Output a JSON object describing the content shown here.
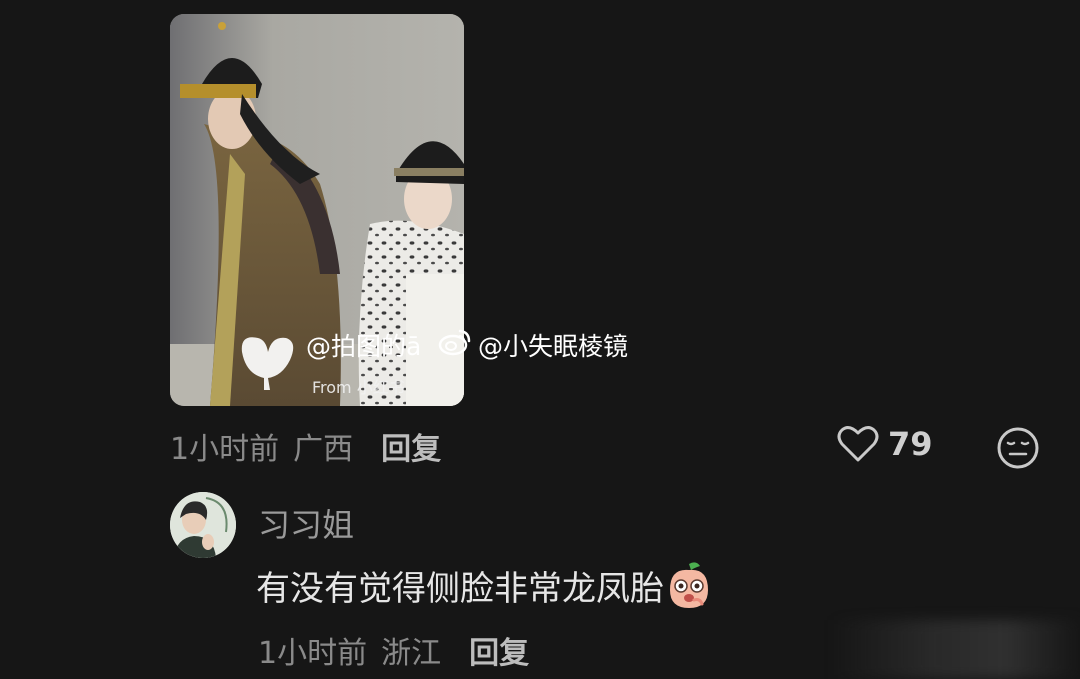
{
  "post_image": {
    "watermark_handle_1": "@拍图的ā",
    "watermark_handle_2": "@小失眠棱镜",
    "watermark_source": "From 小红书"
  },
  "comment_1": {
    "time": "1小时前",
    "location": "广西",
    "reply_label": "回复",
    "like_count": "79"
  },
  "comment_2": {
    "username": "习习姐",
    "text": "有没有觉得侧脸非常龙凤胎",
    "time": "1小时前",
    "location": "浙江",
    "reply_label": "回复"
  },
  "icons": {
    "like": "heart-outline-icon",
    "emoji": "neutral-face-icon",
    "peach": "peach-emoji-icon",
    "weibo": "weibo-logo-icon"
  },
  "colors": {
    "background": "#161616",
    "meta_text": "#8a8a8a",
    "body_text": "#e6e6e6"
  }
}
